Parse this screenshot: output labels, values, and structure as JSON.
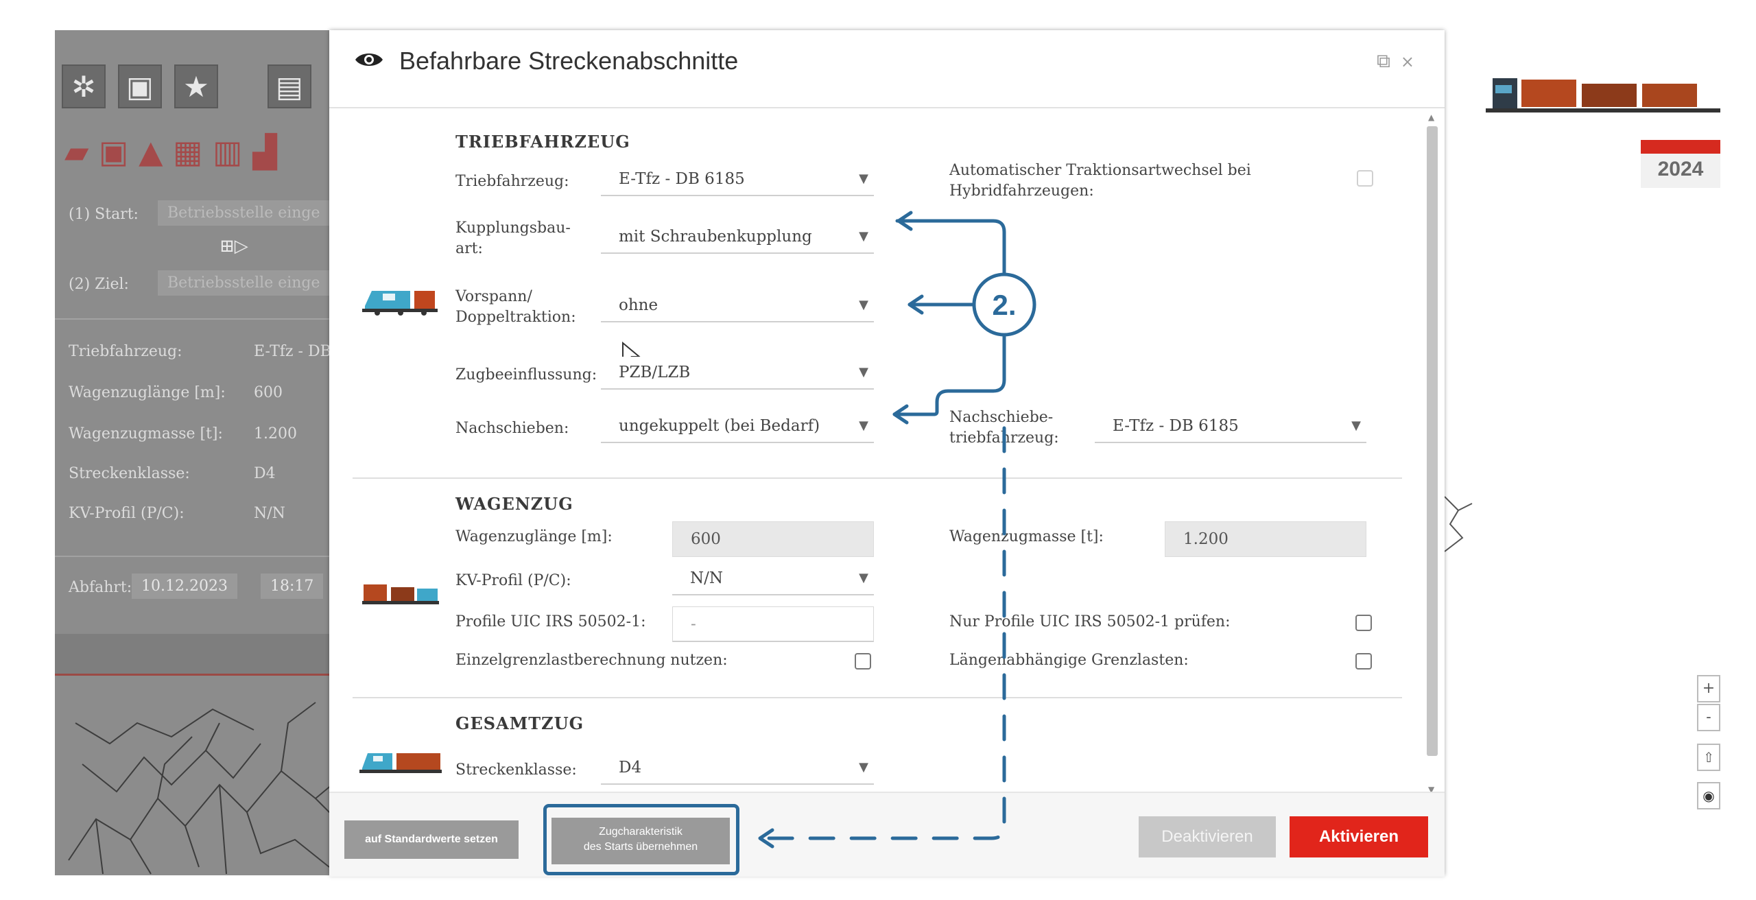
{
  "background": {
    "start_label": "(1) Start:",
    "start_placeholder": "Betriebsstelle einge",
    "ziel_label": "(2) Ziel:",
    "ziel_placeholder": "Betriebsstelle einge",
    "rows": [
      {
        "label": "Triebfahrzeug:",
        "value": "E-Tfz - DB"
      },
      {
        "label": "Wagenzuglänge [m]:",
        "value": "600"
      },
      {
        "label": "Wagenzugmasse [t]:",
        "value": "1.200"
      },
      {
        "label": "Streckenklasse:",
        "value": "D4"
      },
      {
        "label": "KV-Profil (P/C):",
        "value": "N/N"
      }
    ],
    "abfahrt_label": "Abfahrt:",
    "abfahrt_date": "10.12.2023",
    "abfahrt_time": "18:17",
    "year_badge": "2024",
    "map_plus": "+",
    "map_minus": "-"
  },
  "dialog": {
    "title": "Befahrbare Streckenabschnitte",
    "triebfahrzeug_section": {
      "title": "TRIEBFAHRZEUG",
      "triebfahrzeug_label": "Triebfahrzeug:",
      "triebfahrzeug_value": "E-Tfz - DB 6185",
      "kupplung_label": "Kupplungsbau-art:",
      "kupplung_value": "mit Schraubenkupplung",
      "vorspann_label": "Vorspann/ Doppeltraktion:",
      "vorspann_value": "ohne",
      "zugbeeinflussung_label": "Zugbeeinflussung:",
      "zugbeeinflussung_value": "PZB/LZB",
      "nachschieben_label": "Nachschieben:",
      "nachschieben_value": "ungekuppelt (bei Bedarf)",
      "auto_traktion_label": "Automatischer Traktionsartwechsel bei Hybridfahrzeugen:",
      "nachschiebe_tfz_label": "Nachschiebe-triebfahrzeug:",
      "nachschiebe_tfz_value": "E-Tfz - DB 6185"
    },
    "wagenzug_section": {
      "title": "WAGENZUG",
      "laenge_label": "Wagenzuglänge [m]:",
      "laenge_value": "600",
      "masse_label": "Wagenzugmasse [t]:",
      "masse_value": "1.200",
      "kv_label": "KV-Profil (P/C):",
      "kv_value": "N/N",
      "uic_label": "Profile UIC IRS 50502-1:",
      "uic_value": "-",
      "nur_uic_label": "Nur Profile UIC IRS 50502-1 prüfen:",
      "einzel_label": "Einzelgrenzlastberechnung nutzen:",
      "laengen_label": "Längenabhängige Grenzlasten:"
    },
    "gesamtzug_section": {
      "title": "GESAMTZUG",
      "streckenklasse_label": "Streckenklasse:",
      "streckenklasse_value": "D4"
    },
    "footer": {
      "defaults_label": "auf Standardwerte setzen",
      "adopt_line1": "Zugcharakteristik",
      "adopt_line2": "des Starts übernehmen",
      "deactivate_label": "Deaktivieren",
      "activate_label": "Aktivieren"
    }
  },
  "annotation": {
    "step_label": "2.",
    "color": "#2b6a9a"
  },
  "colors": {
    "accent_red": "#e1251b",
    "annotation_blue": "#2b6a9a"
  }
}
